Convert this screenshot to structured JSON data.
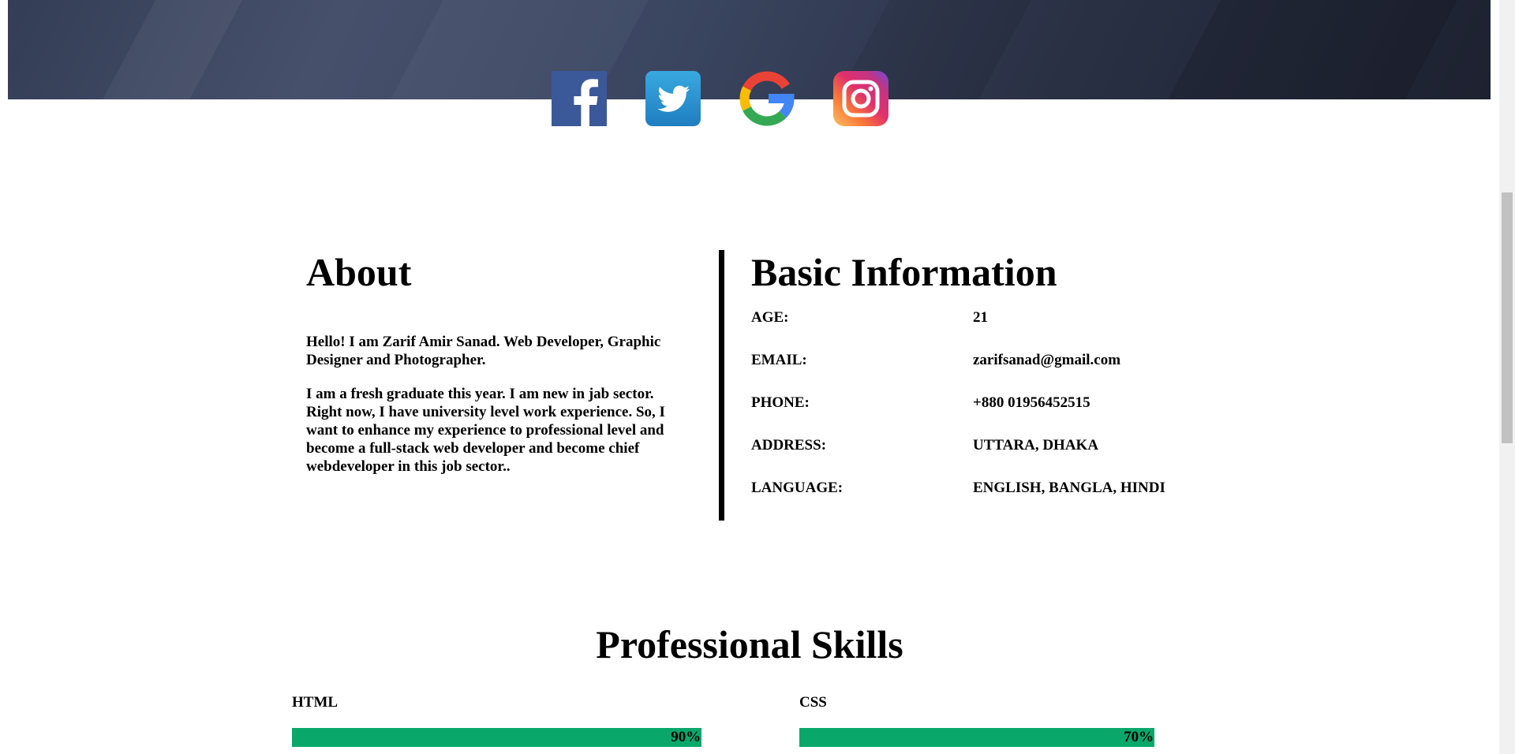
{
  "socials": [
    {
      "name": "facebook",
      "icon": "facebook-icon"
    },
    {
      "name": "twitter",
      "icon": "twitter-icon"
    },
    {
      "name": "google",
      "icon": "google-icon"
    },
    {
      "name": "instagram",
      "icon": "instagram-icon"
    }
  ],
  "about": {
    "title": "About",
    "intro": "Hello! I am Zarif Amir Sanad. Web Developer, Graphic Designer and Photographer.",
    "body": "I am a fresh graduate this year. I am new in jab sector. Right now, I have university level work experience. So, I want to enhance my experience to professional level and become a full-stack web developer and become chief webdeveloper in this job sector.."
  },
  "basic": {
    "title": "Basic Information",
    "rows": [
      {
        "label": "AGE:",
        "value": "21"
      },
      {
        "label": "EMAIL:",
        "value": "zarifsanad@gmail.com"
      },
      {
        "label": "PHONE:",
        "value": "+880 01956452515"
      },
      {
        "label": "ADDRESS:",
        "value": "UTTARA, DHAKA"
      },
      {
        "label": "LANGUAGE:",
        "value": "ENGLISH, BANGLA, HINDI"
      }
    ]
  },
  "skills": {
    "title": "Professional Skills",
    "items": [
      {
        "name": "HTML",
        "percent_label": "90%",
        "level": 0.9
      },
      {
        "name": "CSS",
        "percent_label": "70%",
        "level": 0.7
      }
    ],
    "bar_color": "#09a86a"
  }
}
